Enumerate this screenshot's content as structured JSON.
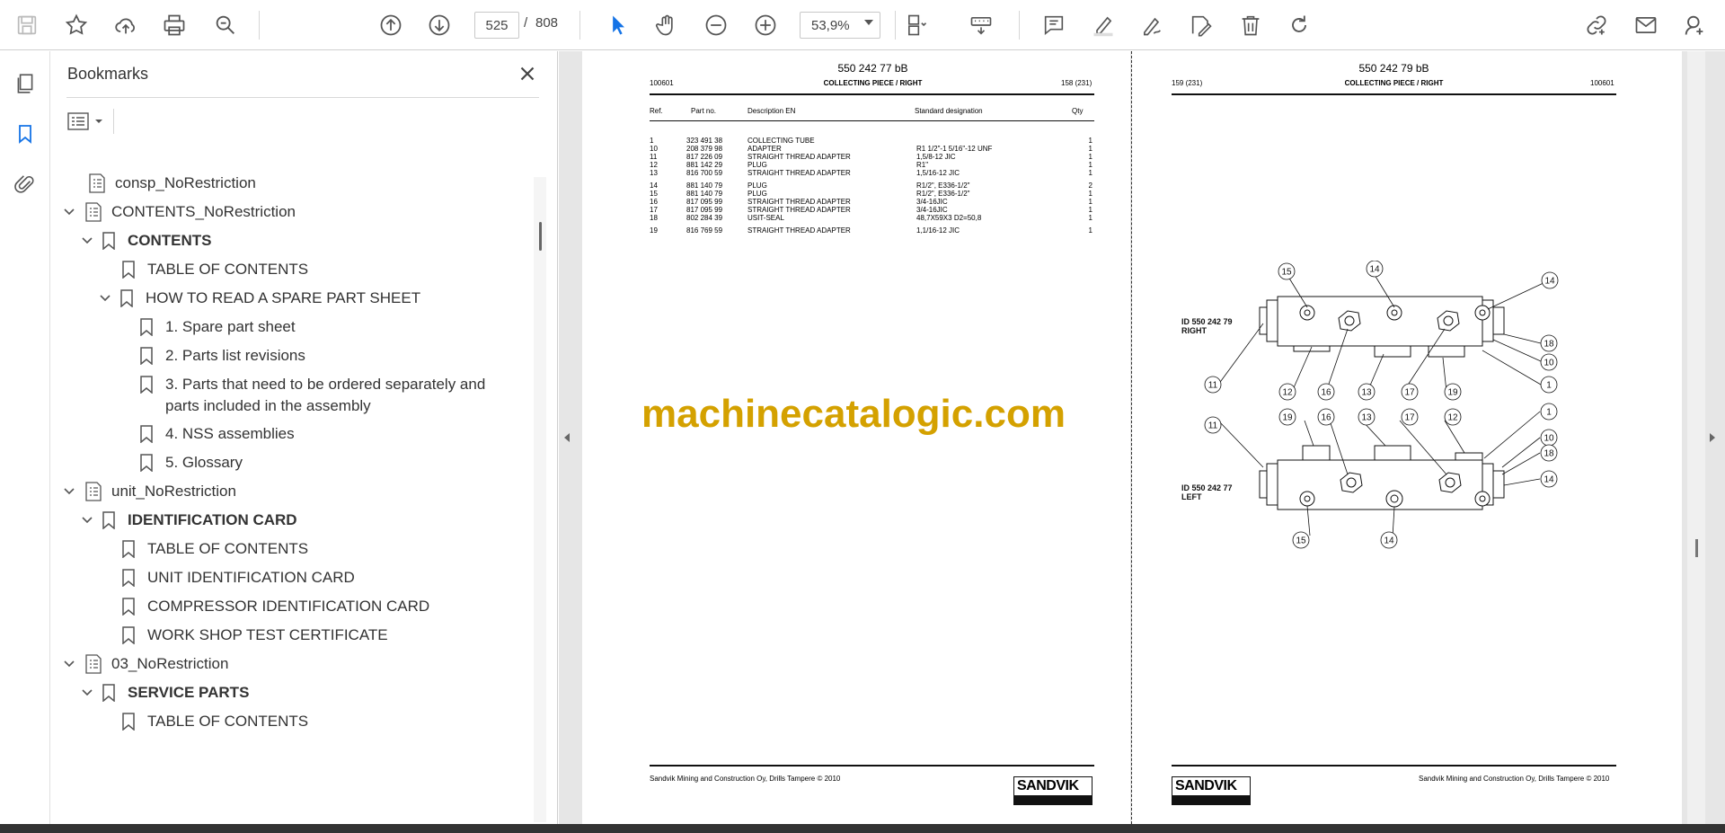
{
  "toolbar": {
    "page_current": "525",
    "page_separator": "/",
    "page_total": "808",
    "zoom": "53,9%"
  },
  "bookmarks_panel": {
    "title": "Bookmarks",
    "items": [
      {
        "label": "consp_NoRestriction"
      },
      {
        "label": "CONTENTS_NoRestriction"
      },
      {
        "label": "CONTENTS"
      },
      {
        "label": "TABLE OF CONTENTS"
      },
      {
        "label": "HOW TO READ A SPARE PART SHEET"
      },
      {
        "label": "1. Spare part sheet"
      },
      {
        "label": "2. Parts list revisions"
      },
      {
        "label": "3. Parts that need to be ordered separately and"
      },
      {
        "label": "parts included in the assembly"
      },
      {
        "label": "4. NSS assemblies"
      },
      {
        "label": "5. Glossary"
      },
      {
        "label": "unit_NoRestriction"
      },
      {
        "label": "IDENTIFICATION CARD"
      },
      {
        "label": "TABLE OF CONTENTS"
      },
      {
        "label": "UNIT IDENTIFICATION CARD"
      },
      {
        "label": "COMPRESSOR IDENTIFICATION CARD"
      },
      {
        "label": "WORK SHOP TEST CERTIFICATE"
      },
      {
        "label": "03_NoRestriction"
      },
      {
        "label": "SERVICE PARTS"
      },
      {
        "label": "TABLE OF CONTENTS"
      }
    ]
  },
  "left_page": {
    "title": "550 242 77 bB",
    "code": "100601",
    "subtitle": "COLLECTING PIECE / RIGHT",
    "page_ref": "158 (231)",
    "columns": [
      "Ref.",
      "Part no.",
      "Description EN",
      "Standard designation",
      "Qty"
    ],
    "rows": [
      [
        "1",
        "323 491 38",
        "COLLECTING TUBE",
        "",
        "1"
      ],
      [
        "10",
        "208 379 98",
        "ADAPTER",
        "R1 1/2\"-1 5/16\"-12 UNF",
        "1"
      ],
      [
        "11",
        "817 226 09",
        "STRAIGHT THREAD ADAPTER",
        "1,5/8-12 JIC",
        "1"
      ],
      [
        "12",
        "881 142 29",
        "PLUG",
        "R1\"",
        "1"
      ],
      [
        "13",
        "816 700 59",
        "STRAIGHT THREAD ADAPTER",
        "1,5/16-12 JIC",
        "1"
      ],
      [
        "14",
        "881 140 79",
        "PLUG",
        "R1/2\", E336-1/2\"",
        "2"
      ],
      [
        "15",
        "881 140 79",
        "PLUG",
        "R1/2\", E336-1/2\"",
        "1"
      ],
      [
        "16",
        "817 095 99",
        "STRAIGHT THREAD ADAPTER",
        "3/4-16JIC",
        "1"
      ],
      [
        "17",
        "817 095 99",
        "STRAIGHT THREAD ADAPTER",
        "3/4-16JIC",
        "1"
      ],
      [
        "18",
        "802 284 39",
        "USIT-SEAL",
        "48,7X59X3 D2=50,8",
        "1"
      ],
      [
        "19",
        "816 769 59",
        "STRAIGHT THREAD ADAPTER",
        "1,1/16-12 JIC",
        "1"
      ]
    ],
    "footer": "Sandvik Mining and Construction Oy, Drills Tampere © 2010",
    "logo": "SANDVIK"
  },
  "right_page": {
    "title": "550 242 79 bB",
    "page_ref": "159 (231)",
    "subtitle": "COLLECTING PIECE / RIGHT",
    "code": "100601",
    "label_right": "ID 550 242 79",
    "label_right2": "RIGHT",
    "label_left": "ID 550 242 77",
    "label_left2": "LEFT",
    "footer": "Sandvik Mining and Construction Oy, Drills Tampere © 2010",
    "logo": "SANDVIK"
  },
  "watermark": "machinecatalogic.com"
}
